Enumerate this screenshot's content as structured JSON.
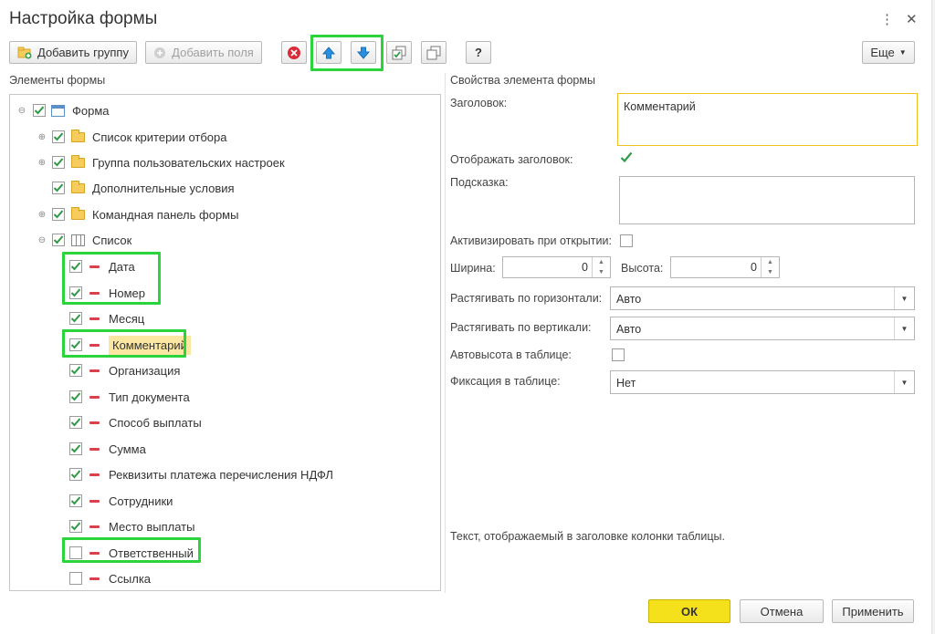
{
  "window": {
    "title": "Настройка формы",
    "menu_icon": "more-vert-icon",
    "close_icon": "close-icon"
  },
  "toolbar": {
    "add_group": "Добавить группу",
    "add_fields": "Добавить поля",
    "help": "?",
    "more": "Еще"
  },
  "left_panel": {
    "label": "Элементы формы"
  },
  "tree": {
    "root": "Форма",
    "groups": [
      "Список критерии отбора",
      "Группа пользовательских настроек",
      "Дополнительные условия",
      "Командная панель формы",
      "Список"
    ],
    "items": [
      {
        "label": "Дата",
        "checked": true
      },
      {
        "label": "Номер",
        "checked": true
      },
      {
        "label": "Месяц",
        "checked": true
      },
      {
        "label": "Комментарий",
        "checked": true,
        "selected": true
      },
      {
        "label": "Организация",
        "checked": true
      },
      {
        "label": "Тип документа",
        "checked": true
      },
      {
        "label": "Способ выплаты",
        "checked": true
      },
      {
        "label": "Сумма",
        "checked": true
      },
      {
        "label": "Реквизиты платежа перечисления НДФЛ",
        "checked": true
      },
      {
        "label": "Сотрудники",
        "checked": true
      },
      {
        "label": "Место выплаты",
        "checked": true
      },
      {
        "label": "Ответственный",
        "checked": false
      },
      {
        "label": "Ссылка",
        "checked": false
      }
    ]
  },
  "properties": {
    "section_label": "Свойства элемента формы",
    "caption_label": "Заголовок:",
    "caption_value": "Комментарий",
    "show_caption_label": "Отображать заголовок:",
    "hint_label": "Подсказка:",
    "activate_label": "Активизировать при открытии:",
    "width_label": "Ширина:",
    "width_value": "0",
    "height_label": "Высота:",
    "height_value": "0",
    "stretch_h_label": "Растягивать по горизонтали:",
    "stretch_h_value": "Авто",
    "stretch_v_label": "Растягивать по вертикали:",
    "stretch_v_value": "Авто",
    "autoheight_label": "Автовысота в таблице:",
    "fix_label": "Фиксация в таблице:",
    "fix_value": "Нет",
    "description": "Текст, отображаемый в заголовке колонки таблицы."
  },
  "footer": {
    "ok": "ОК",
    "cancel": "Отмена",
    "apply": "Применить"
  },
  "colors": {
    "highlight": "#2bd43a",
    "check": "#2f9a47",
    "ok_button": "#f5e11b",
    "focus_border": "#f0c020"
  }
}
